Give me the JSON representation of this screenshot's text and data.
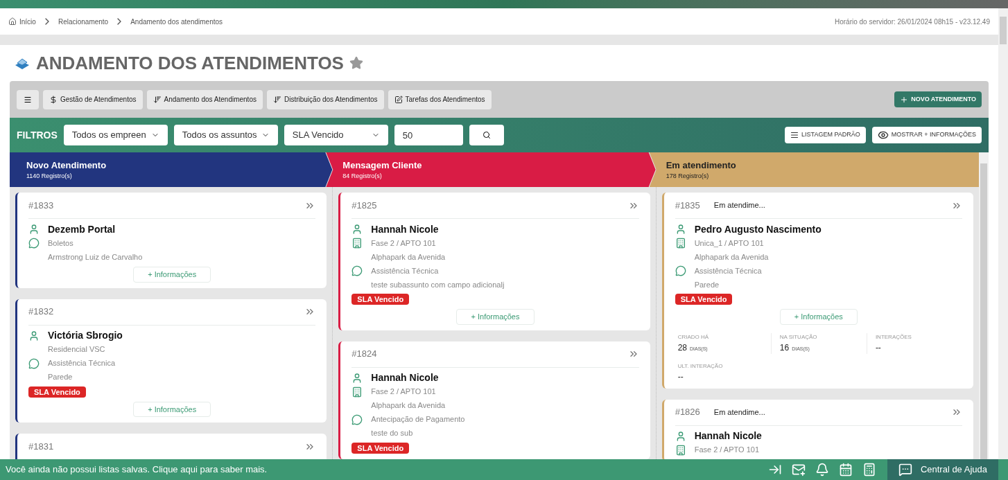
{
  "breadcrumb": {
    "items": [
      "Início",
      "Relacionamento",
      "Andamento dos atendimentos"
    ],
    "server_time": "Horário do servidor: 26/01/2024 08h15 - v23.12.49"
  },
  "page_title": "ANDAMENTO DOS ATENDIMENTOS",
  "toolbar": {
    "tabs": [
      {
        "kind": "dollar",
        "label": "Gestão de Atendimentos"
      },
      {
        "kind": "sort",
        "label": "Andamento dos Atendimentos"
      },
      {
        "kind": "sort",
        "label": "Distribuição dos Atendimentos"
      },
      {
        "kind": "edit",
        "label": "Tarefas dos Atendimentos"
      }
    ],
    "new_button": "NOVO ATENDIMENTO"
  },
  "filters": {
    "label": "FILTROS",
    "selects": [
      "Todos os empreen",
      "Todos os assuntos",
      "SLA Vencido"
    ],
    "limit": "50",
    "buttons": [
      {
        "kind": "list",
        "label": "LISTAGEM PADRÃO"
      },
      {
        "kind": "eye",
        "label": "MOSTRAR + INFORMAÇÕES"
      }
    ]
  },
  "columns": [
    {
      "title": "Novo Atendimento",
      "count": "1140 Registro(s)",
      "color": "#22357f",
      "cards": [
        {
          "id": "#1833",
          "lines": [
            {
              "kind": "person",
              "text": "Dezemb Portal"
            },
            {
              "kind": "chat",
              "text": "Boletos"
            },
            {
              "kind": "plain",
              "text": "Armstrong Luiz de Carvalho"
            }
          ],
          "info": "+ Informações"
        },
        {
          "id": "#1832",
          "lines": [
            {
              "kind": "person",
              "text": "Victória Sbrogio"
            },
            {
              "kind": "plain",
              "text": "Residencial VSC"
            },
            {
              "kind": "chat",
              "text": "Assistência Técnica"
            },
            {
              "kind": "plain",
              "text": "Parede"
            }
          ],
          "badge": "SLA Vencido",
          "info": "+ Informações"
        },
        {
          "id": "#1831"
        }
      ]
    },
    {
      "title": "Mensagem Cliente",
      "count": "84 Registro(s)",
      "color": "#d91c45",
      "cards": [
        {
          "id": "#1825",
          "lines": [
            {
              "kind": "person",
              "text": "Hannah Nicole"
            },
            {
              "kind": "building",
              "text": "Fase 2 / APTO 101"
            },
            {
              "kind": "plain",
              "text": "Alphapark da Avenida"
            },
            {
              "kind": "chat",
              "text": "Assistência Técnica"
            },
            {
              "kind": "plain",
              "text": "teste subassunto com campo adicionalj"
            }
          ],
          "badge": "SLA Vencido",
          "info": "+ Informações"
        },
        {
          "id": "#1824",
          "lines": [
            {
              "kind": "person",
              "text": "Hannah Nicole"
            },
            {
              "kind": "building",
              "text": "Fase 2 / APTO 101"
            },
            {
              "kind": "plain",
              "text": "Alphapark da Avenida"
            },
            {
              "kind": "chat",
              "text": "Antecipação de Pagamento"
            },
            {
              "kind": "plain",
              "text": "teste do sub"
            }
          ],
          "badge": "SLA Vencido"
        }
      ]
    },
    {
      "title": "Em atendimento",
      "count": "178 Registro(s)",
      "color": "#d0a96b",
      "cards": [
        {
          "id": "#1835",
          "status": "Em atendime...",
          "lines": [
            {
              "kind": "person",
              "text": "Pedro Augusto Nascimento"
            },
            {
              "kind": "building",
              "text": "Unica_1 / APTO 101"
            },
            {
              "kind": "plain",
              "text": "Alphapark da Avenida"
            },
            {
              "kind": "chat",
              "text": "Assistência Técnica"
            },
            {
              "kind": "plain",
              "text": "Parede"
            }
          ],
          "badge": "SLA Vencido",
          "info": "+ Informações",
          "stats": [
            {
              "label": "CRIADO HÁ",
              "value": "28",
              "unit": "DIAS(S)"
            },
            {
              "label": "NA SITUAÇÃO",
              "value": "16",
              "unit": "DIAS(S)"
            },
            {
              "label": "INTERAÇÕES",
              "value": "--"
            },
            {
              "label": "ULT. INTERAÇÃO",
              "value": "--"
            }
          ]
        },
        {
          "id": "#1826",
          "status": "Em atendime...",
          "lines": [
            {
              "kind": "person",
              "text": "Hannah Nicole"
            },
            {
              "kind": "building",
              "text": "Fase 2 / APTO 101"
            }
          ]
        }
      ]
    }
  ],
  "footer": {
    "message": "Você ainda não possui listas salvas. Clique aqui para saber mais.",
    "help": "Central de Ajuda"
  }
}
